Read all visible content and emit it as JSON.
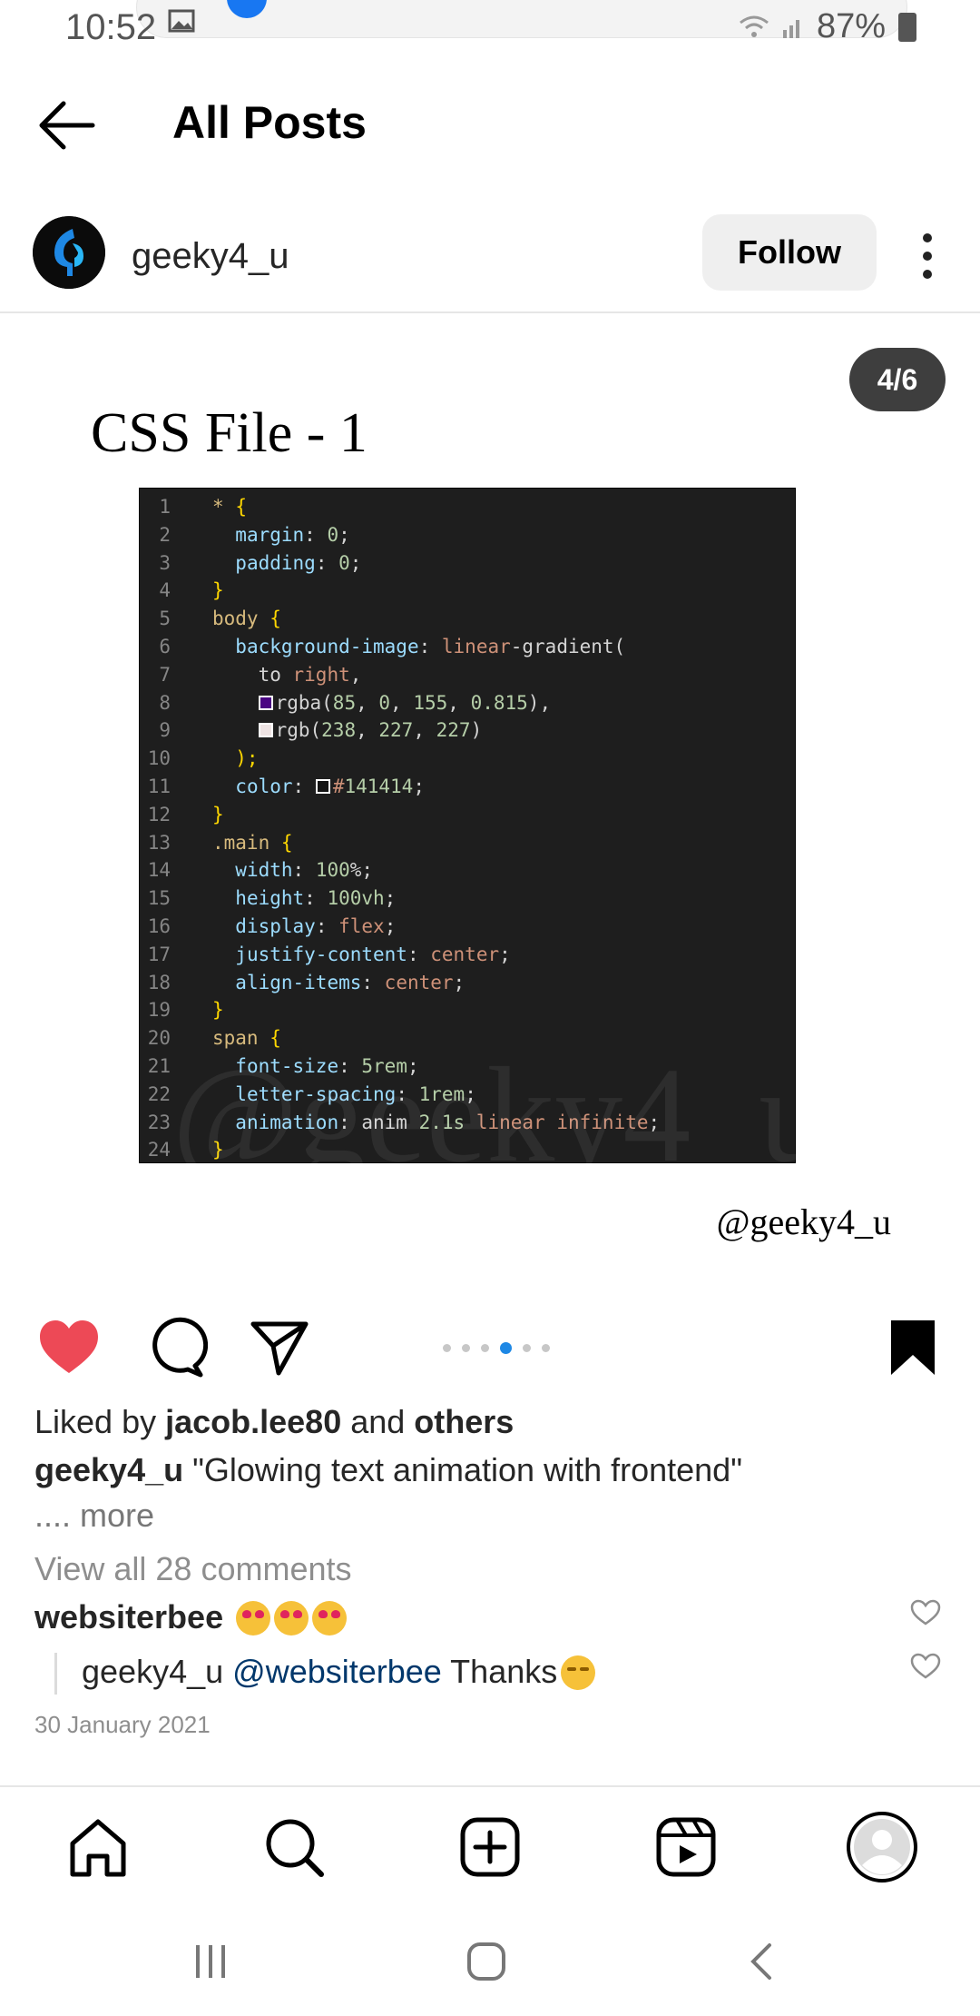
{
  "status_bar": {
    "time": "10:52",
    "battery": "87%"
  },
  "header": {
    "title": "All Posts"
  },
  "post": {
    "username": "geeky4_u",
    "follow_label": "Follow",
    "page_indicator": "4/6",
    "slide_title": "CSS File - 1",
    "code_lines": [
      "* {",
      "  margin: 0;",
      "  padding: 0;",
      "}",
      "body {",
      "  background-image: linear-gradient(",
      "    to right,",
      "    rgba(85, 0, 155, 0.815),",
      "    rgb(238, 227, 227)",
      "  );",
      "  color: #141414;",
      "}",
      ".main {",
      "  width: 100%;",
      "  height: 100vh;",
      "  display: flex;",
      "  justify-content: center;",
      "  align-items: center;",
      "}",
      "span {",
      "  font-size: 5rem;",
      "  letter-spacing: 1rem;",
      "  animation: anim 2.1s linear infinite;",
      "}"
    ],
    "watermark": "@geeky4_u",
    "credit": "@geeky4_u",
    "carousel": {
      "count": 6,
      "active_index": 3
    },
    "liked_by_prefix": "Liked by ",
    "liked_by_user": "jacob.lee80",
    "liked_by_and": " and ",
    "liked_by_others": "others",
    "caption_user": "geeky4_u",
    "caption_text": " \"Glowing text animation with frontend\"",
    "more_label": ".... more",
    "view_comments": "View all 28 comments",
    "comments": [
      {
        "user": "websiterbee",
        "text": ""
      },
      {
        "user": "geeky4_u",
        "mention": "@websiterbee",
        "text": " Thanks"
      }
    ],
    "date": "30 January 2021"
  },
  "colors": {
    "like": "#ed4956",
    "mention": "#00376b",
    "carousel_active": "#1e88e5"
  },
  "icons": [
    "back-arrow-icon",
    "more-vert-icon",
    "heart-icon",
    "comment-icon",
    "share-icon",
    "bookmark-icon",
    "home-icon",
    "search-icon",
    "add-post-icon",
    "reels-icon",
    "profile-icon"
  ]
}
